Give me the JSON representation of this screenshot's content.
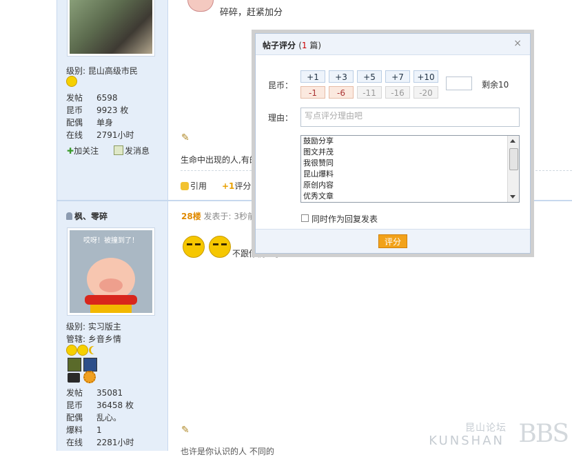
{
  "post1": {
    "top_text": "碎碎，赶紧加分",
    "level": "级别: 昆山高级市民",
    "stats": [
      {
        "k": "发帖",
        "v": "6598"
      },
      {
        "k": "昆币",
        "v": "9923 枚"
      },
      {
        "k": "配偶",
        "v": "单身"
      },
      {
        "k": "在线",
        "v": "2791小时"
      }
    ],
    "follow": "加关注",
    "message": "发消息",
    "content": "生命中出现的人,有的",
    "quote": "引用",
    "rate": "评分"
  },
  "post2": {
    "username": "枫、零碎",
    "floor": "28楼",
    "posted": "发表于: 3秒前",
    "avatar_text": "哎呀！被撞到了！",
    "content": "不跟你们玩了",
    "level": "级别: 实习版主",
    "manage": "管辖: 乡音乡情",
    "stats": [
      {
        "k": "发帖",
        "v": "35081"
      },
      {
        "k": "昆币",
        "v": "36458 枚"
      },
      {
        "k": "配偶",
        "v": "乱心。"
      },
      {
        "k": "爆料",
        "v": "1"
      },
      {
        "k": "在线",
        "v": "2281小时"
      }
    ],
    "bottom_text": "也许是你认识的人 不同的"
  },
  "dialog": {
    "title": "帖子评分",
    "count_open": "(",
    "count_num": "1",
    "count_close": " 篇)",
    "close": "×",
    "coin_label": "昆币：",
    "positive": [
      "+1",
      "+3",
      "+5",
      "+7",
      "+10"
    ],
    "negative": [
      "-1",
      "-6",
      "-11",
      "-16",
      "-20"
    ],
    "remaining": "剩余10",
    "reason_label": "理由：",
    "reason_placeholder": "写点评分理由吧",
    "reasons": [
      "鼓励分享",
      "图文并茂",
      "我很赞同",
      "昆山爆料",
      "原创内容",
      "优秀文章"
    ],
    "also_reply": "同时作为回复发表",
    "submit": "评分"
  },
  "watermark": {
    "cn": "昆山论坛",
    "en": "KUNSHAN",
    "bbs": "BBS"
  }
}
